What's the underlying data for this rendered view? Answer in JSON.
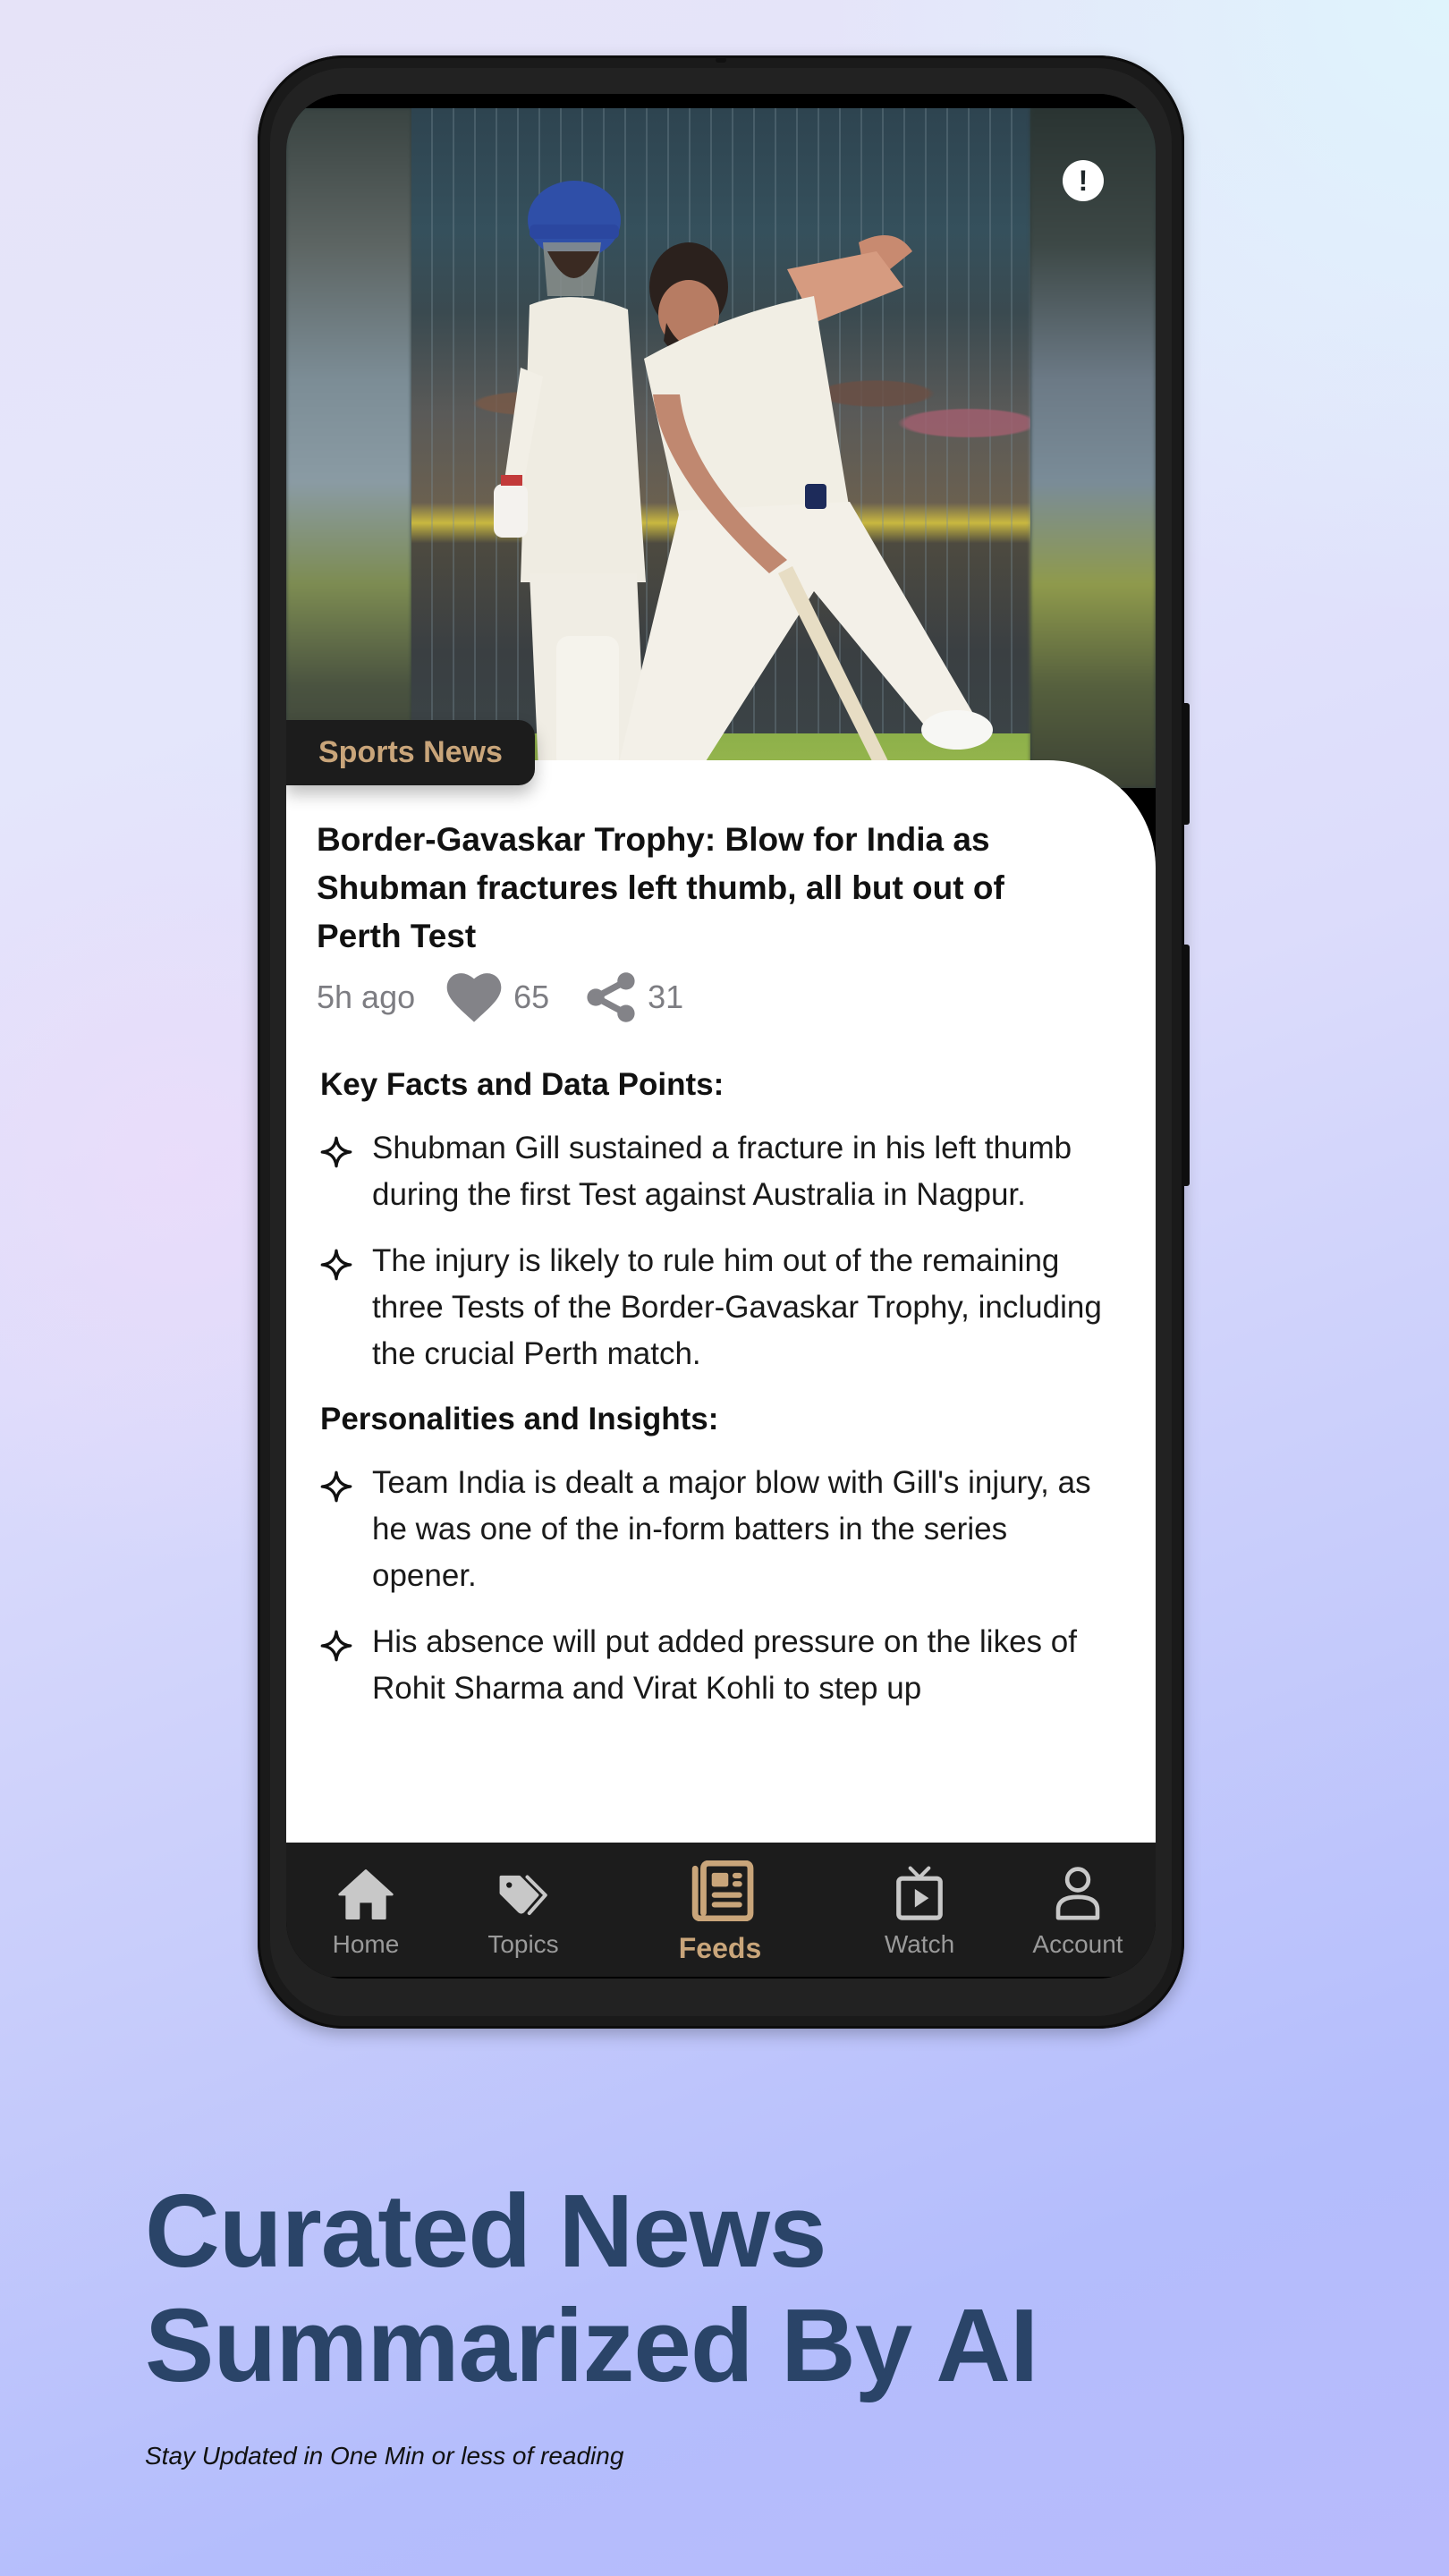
{
  "app": {
    "accent_color": "#c9a57a",
    "nav_background": "#1c1c1c"
  },
  "article": {
    "category": "Sports News",
    "alert_icon": "exclamation-circle-icon",
    "headline": "Border-Gavaskar Trophy: Blow for India as Shubman fractures left thumb, all but out of Perth Test",
    "time_ago": "5h ago",
    "likes": "65",
    "shares": "31",
    "sections": [
      {
        "title": "Key Facts and Data Points:",
        "bullets": [
          "Shubman Gill sustained a fracture in his left thumb during the first Test against Australia in Nagpur.",
          "The injury is likely to rule him out of the remaining three Tests of the Border-Gavaskar Trophy, including the crucial Perth match."
        ]
      },
      {
        "title": "Personalities and Insights:",
        "bullets": [
          "Team India is dealt a major blow with Gill's injury, as he was one of the in-form batters in the series opener.",
          "His absence will put added pressure on the likes of Rohit Sharma and Virat Kohli to step up"
        ]
      }
    ]
  },
  "nav": {
    "items": [
      {
        "label": "Home",
        "icon": "home-icon",
        "active": false
      },
      {
        "label": "Topics",
        "icon": "tags-icon",
        "active": false
      },
      {
        "label": "Feeds",
        "icon": "newspaper-icon",
        "active": true
      },
      {
        "label": "Watch",
        "icon": "tv-play-icon",
        "active": false
      },
      {
        "label": "Account",
        "icon": "user-icon",
        "active": false
      }
    ]
  },
  "promo": {
    "title_line1": "Curated News",
    "title_line2": "Summarized By AI",
    "subtitle": "Stay Updated in One Min or less of reading"
  }
}
